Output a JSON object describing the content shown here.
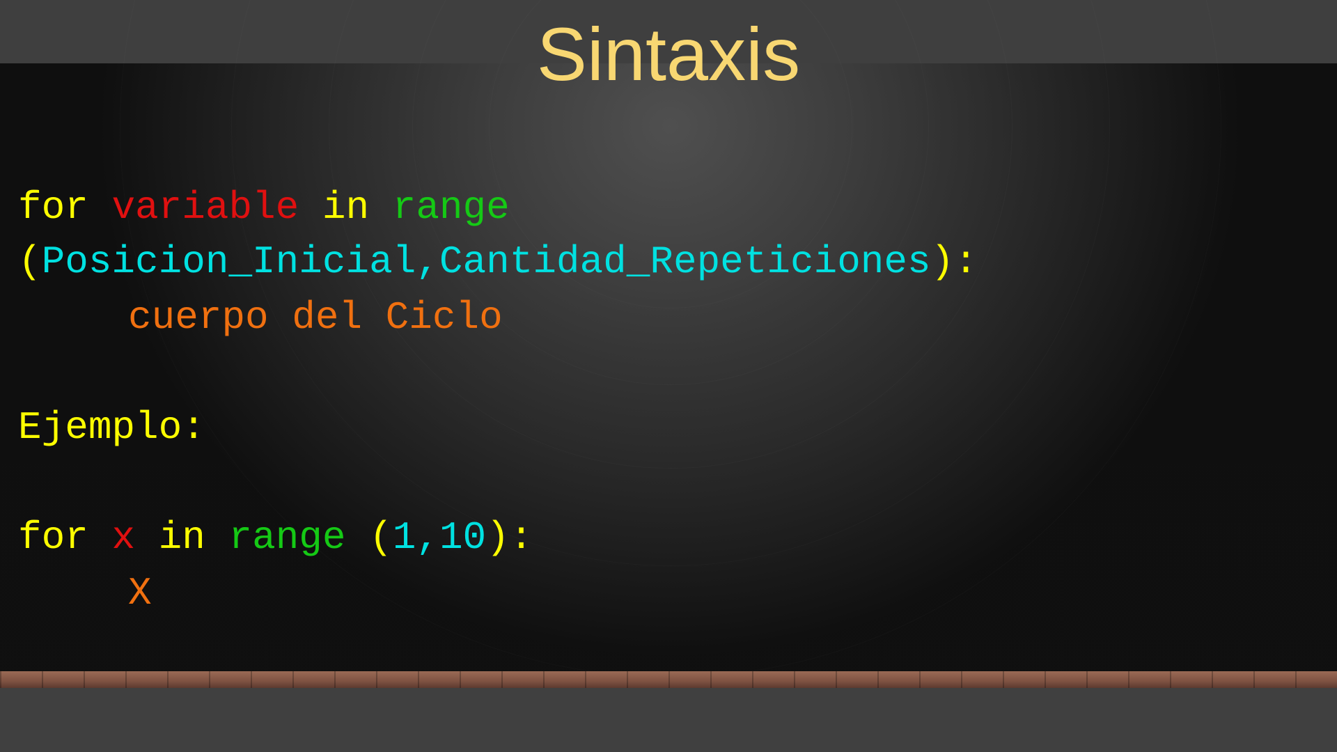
{
  "title": "Sintaxis",
  "syntax": {
    "line1": {
      "for": "for",
      "variable": "variable",
      "in": "in",
      "range": "range"
    },
    "line2": {
      "open_paren": "(",
      "args": "Posicion_Inicial,Cantidad_Repeticiones",
      "close": "):"
    },
    "body": "cuerpo del Ciclo"
  },
  "example_label": "Ejemplo:",
  "example": {
    "for": "for",
    "var": "x",
    "in": "in",
    "range": "range",
    "open_paren": "(",
    "args": "1,10",
    "close": "):",
    "body": "X"
  },
  "colors": {
    "title": "#f8d772",
    "keyword": "#ffff00",
    "variable": "#e01010",
    "function": "#15c915",
    "arguments": "#00e1e1",
    "body": "#f07010"
  }
}
